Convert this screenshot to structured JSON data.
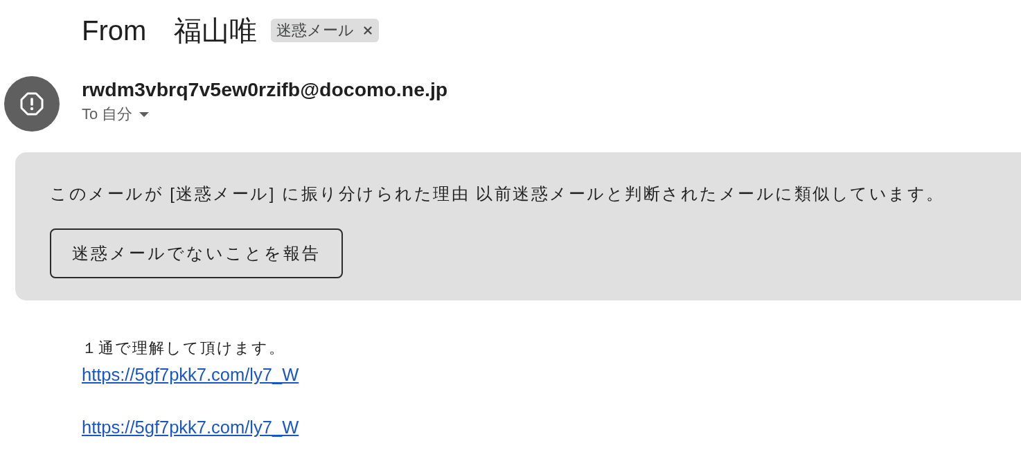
{
  "subject": {
    "title": "From　福山唯",
    "label": {
      "text": "迷惑メール"
    }
  },
  "sender": {
    "email": "rwdm3vbrq7v5ew0rzifb@docomo.ne.jp",
    "recipients": "To 自分"
  },
  "spam_banner": {
    "message": "このメールが [迷惑メール] に振り分けられた理由 以前迷惑メールと判断されたメールに類似しています。",
    "button": "迷惑メールでないことを報告"
  },
  "body": {
    "paragraphs": [
      {
        "lines": [
          {
            "kind": "text",
            "text": "１通で理解して頂けます。"
          },
          {
            "kind": "link",
            "text": "https://5gf7pkk7.com/ly7_W"
          }
        ]
      },
      {
        "lines": [
          {
            "kind": "link",
            "text": "https://5gf7pkk7.com/ly7_W"
          }
        ]
      }
    ]
  }
}
